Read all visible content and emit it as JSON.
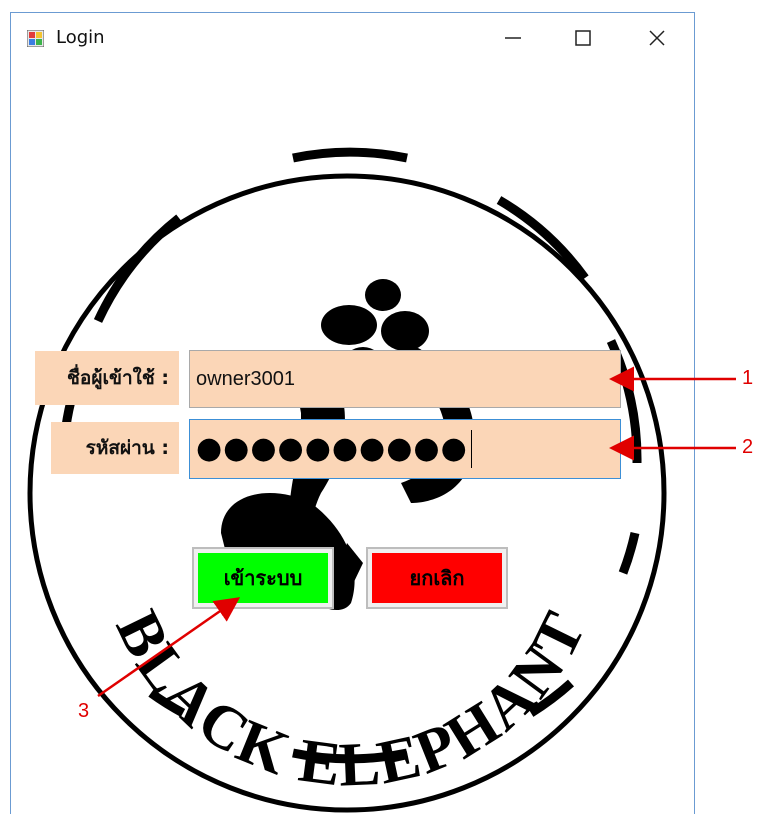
{
  "window": {
    "title": "Login"
  },
  "logo": {
    "text": "BLACK ELEPHANT"
  },
  "form": {
    "username_label": "ชื่อผู้เข้าใช้ :",
    "username_value": "owner3001",
    "password_label": "รหัสผ่าน :",
    "password_masked": "●●●●●●●●●●",
    "login_button": "เข้าระบบ",
    "cancel_button": "ยกเลิก"
  },
  "annotations": {
    "a1": "1",
    "a2": "2",
    "a3": "3"
  },
  "colors": {
    "field_bg": "#fbd6b7",
    "login_bg": "#00ff00",
    "cancel_bg": "#ff0000",
    "annotation": "#e00000"
  },
  "icons": [
    "app-icon",
    "minimize-icon",
    "maximize-icon",
    "close-icon"
  ]
}
